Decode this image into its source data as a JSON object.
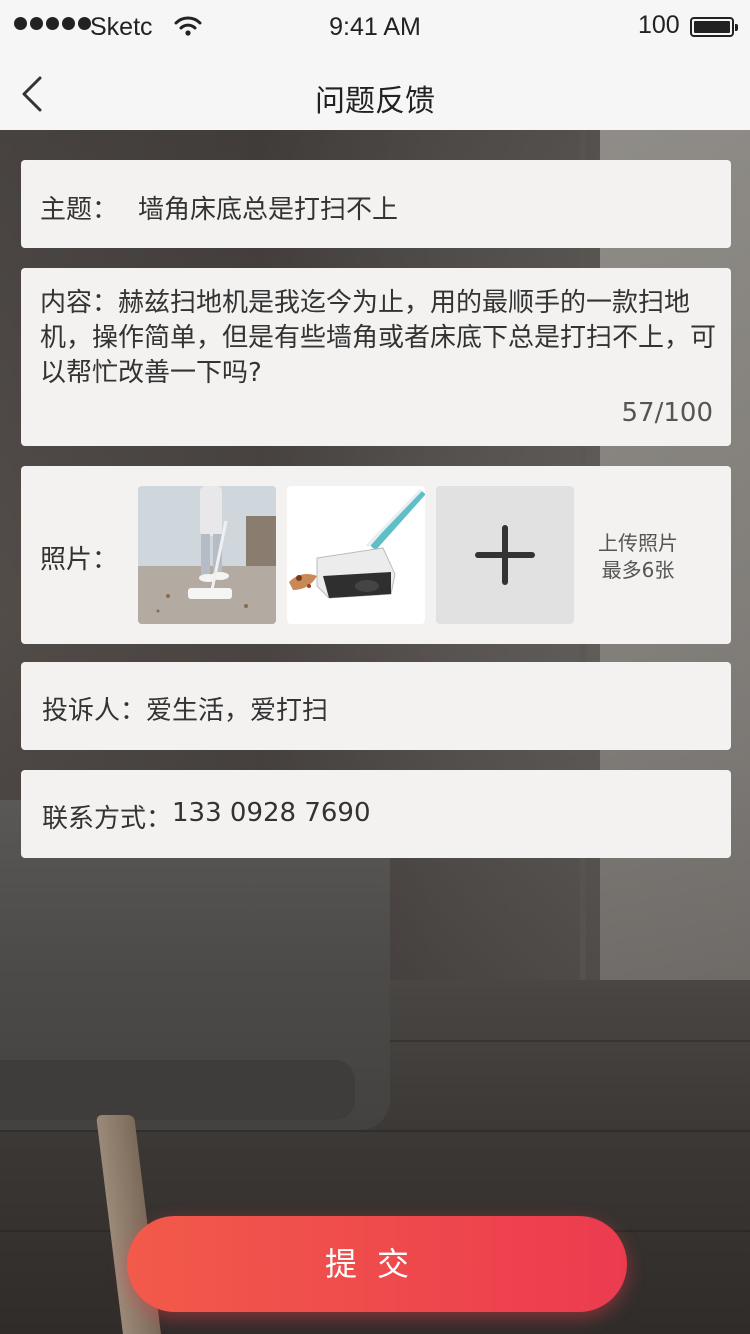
{
  "status_bar": {
    "carrier": "Sketc",
    "time": "9:41 AM",
    "battery_percent": "100"
  },
  "nav": {
    "title": "问题反馈",
    "back_icon": "chevron-left-icon"
  },
  "form": {
    "subject": {
      "label": "主题：",
      "value": "墙角床底总是打扫不上"
    },
    "content": {
      "label": "内容：",
      "value": "赫兹扫地机是我迄今为止，用的最顺手的一款扫地机，操作简单，但是有些墙角或者床底下总是打扫不上，可以帮忙改善一下吗?",
      "count": "57/100"
    },
    "photos": {
      "label": "照片：",
      "upload_line1": "上传照片",
      "upload_line2": "最多6张"
    },
    "complainant": {
      "label": "投诉人：",
      "value": "爱生活，爱打扫"
    },
    "contact": {
      "label": "联系方式：",
      "value": "133 0928 7690"
    }
  },
  "submit_label": "提交",
  "colors": {
    "accent_start": "#f25a4a",
    "accent_end": "#ec3b4f",
    "card_bg": "#f3f2f1",
    "bar_bg": "#f6f6f6"
  }
}
